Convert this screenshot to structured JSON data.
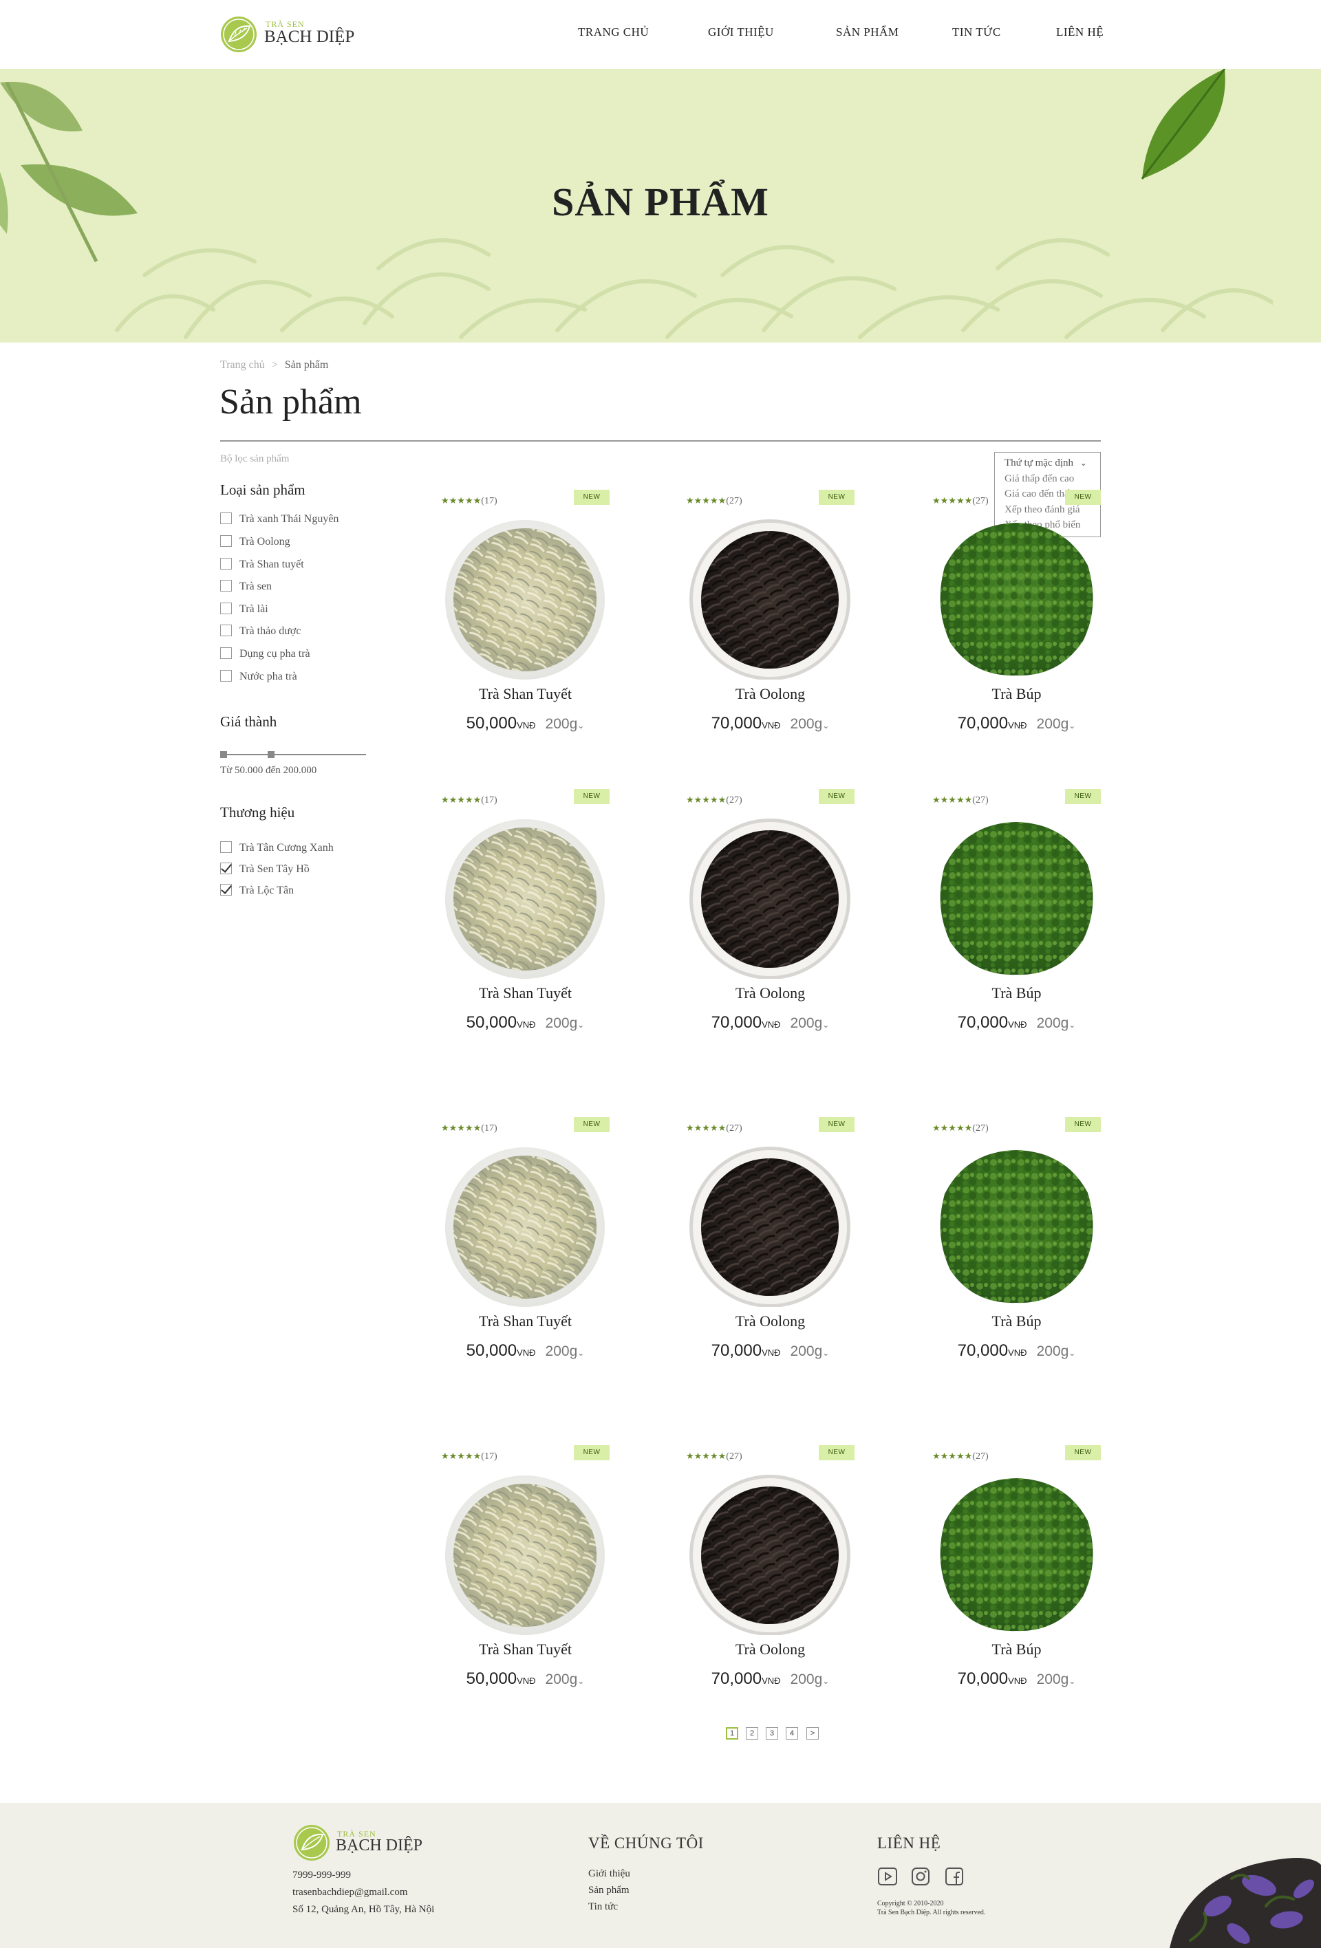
{
  "brand": {
    "small": "TRÀ SEN",
    "name": "BẠCH DIỆP"
  },
  "nav": [
    "TRANG CHỦ",
    "GIỚI THIỆU",
    "SẢN PHẨM",
    "TIN TỨC",
    "LIÊN HỆ"
  ],
  "hero": {
    "title": "SẢN PHẨM"
  },
  "breadcrumb": {
    "home": "Trang chủ",
    "sep": ">",
    "current": "Sản phẩm"
  },
  "page_title": "Sản phẩm",
  "filter_label": "Bộ lọc sản phẩm",
  "sort": {
    "options": [
      "Thứ tự mặc định",
      "Giá thấp đến cao",
      "Giá cao đến thấp",
      "Xếp theo đánh giá",
      "Xếp theo phổ biến"
    ],
    "chevron": "⌄"
  },
  "sidebar": {
    "category_title": "Loại sản phẩm",
    "categories": [
      {
        "label": "Trà xanh Thái Nguyên",
        "checked": false
      },
      {
        "label": "Trà Oolong",
        "checked": false
      },
      {
        "label": "Trà Shan tuyết",
        "checked": false
      },
      {
        "label": "Trà sen",
        "checked": false
      },
      {
        "label": "Trà lài",
        "checked": false
      },
      {
        "label": "Trà thảo dược",
        "checked": false
      },
      {
        "label": "Dụng cụ pha trà",
        "checked": false
      },
      {
        "label": "Nước pha trà",
        "checked": false
      }
    ],
    "price_title": "Giá thành",
    "price_range_text": "Từ 50.000 đến 200.000",
    "price_range": {
      "min": 50000,
      "max": 200000
    },
    "brand_title": "Thương hiệu",
    "brands": [
      {
        "label": "Trà Tân Cương Xanh",
        "checked": false
      },
      {
        "label": "Trà Sen Tây Hồ",
        "checked": true
      },
      {
        "label": "Trà Lộc Tân",
        "checked": true
      }
    ]
  },
  "products": [
    {
      "name": "Trà Shan Tuyết",
      "stars": "★★★★★",
      "reviews": "(17)",
      "badge": "NEW",
      "price": "50,000",
      "currency": "VNĐ",
      "weight": "200g",
      "image": "white-tea-bowl"
    },
    {
      "name": "Trà Oolong",
      "stars": "★★★★★",
      "reviews": "(27)",
      "badge": "NEW",
      "price": "70,000",
      "currency": "VNĐ",
      "weight": "200g",
      "image": "black-tea-bowl"
    },
    {
      "name": "Trà Búp",
      "stars": "★★★★★",
      "reviews": "(27)",
      "badge": "NEW",
      "price": "70,000",
      "currency": "VNĐ",
      "weight": "200g",
      "image": "green-tea-pile"
    },
    {
      "name": "Trà Shan Tuyết",
      "stars": "★★★★★",
      "reviews": "(17)",
      "badge": "NEW",
      "price": "50,000",
      "currency": "VNĐ",
      "weight": "200g",
      "image": "white-tea-bowl"
    },
    {
      "name": "Trà Oolong",
      "stars": "★★★★★",
      "reviews": "(27)",
      "badge": "NEW",
      "price": "70,000",
      "currency": "VNĐ",
      "weight": "200g",
      "image": "black-tea-bowl"
    },
    {
      "name": "Trà Búp",
      "stars": "★★★★★",
      "reviews": "(27)",
      "badge": "NEW",
      "price": "70,000",
      "currency": "VNĐ",
      "weight": "200g",
      "image": "green-tea-pile"
    },
    {
      "name": "Trà Shan Tuyết",
      "stars": "★★★★★",
      "reviews": "(17)",
      "badge": "NEW",
      "price": "50,000",
      "currency": "VNĐ",
      "weight": "200g",
      "image": "white-tea-bowl"
    },
    {
      "name": "Trà Oolong",
      "stars": "★★★★★",
      "reviews": "(27)",
      "badge": "NEW",
      "price": "70,000",
      "currency": "VNĐ",
      "weight": "200g",
      "image": "black-tea-bowl"
    },
    {
      "name": "Trà Búp",
      "stars": "★★★★★",
      "reviews": "(27)",
      "badge": "NEW",
      "price": "70,000",
      "currency": "VNĐ",
      "weight": "200g",
      "image": "green-tea-pile"
    },
    {
      "name": "Trà Shan Tuyết",
      "stars": "★★★★★",
      "reviews": "(17)",
      "badge": "NEW",
      "price": "50,000",
      "currency": "VNĐ",
      "weight": "200g",
      "image": "white-tea-bowl"
    },
    {
      "name": "Trà Oolong",
      "stars": "★★★★★",
      "reviews": "(27)",
      "badge": "NEW",
      "price": "70,000",
      "currency": "VNĐ",
      "weight": "200g",
      "image": "black-tea-bowl"
    },
    {
      "name": "Trà Búp",
      "stars": "★★★★★",
      "reviews": "(27)",
      "badge": "NEW",
      "price": "70,000",
      "currency": "VNĐ",
      "weight": "200g",
      "image": "green-tea-pile"
    }
  ],
  "weight_chevron": "⌄",
  "pagination": {
    "pages": [
      "1",
      "2",
      "3",
      "4"
    ],
    "next": ">",
    "current": "1"
  },
  "footer": {
    "brand_small": "TRÀ SEN",
    "brand_name": "BẠCH DIỆP",
    "phone": "7999-999-999",
    "email": "trasenbachdiep@gmail.com",
    "address": "Số 12, Quảng An, Hồ Tây, Hà Nội",
    "about_title": "VỀ CHÚNG TÔI",
    "about_links": [
      "Giới thiệu",
      "Sản phẩm",
      "Tin tức"
    ],
    "contact_title": "LIÊN HỆ",
    "social": [
      "youtube-icon",
      "instagram-icon",
      "facebook-icon"
    ],
    "copyright": "Copyright © 2010-2020",
    "rights": "Trà Sen Bạch Diệp. All rights reserved."
  },
  "colors": {
    "accent": "#9cbf3f",
    "hero_bg": "#e6efc4",
    "badge_bg": "#d9eea7",
    "footer_bg": "#f0f0e8",
    "star": "#6a8a2a"
  }
}
